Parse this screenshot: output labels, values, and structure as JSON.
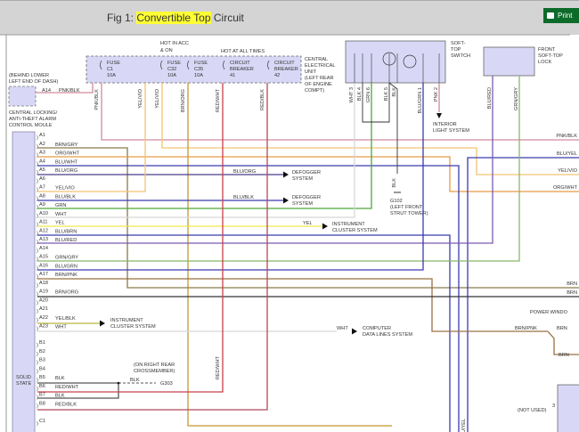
{
  "header": {
    "title_prefix": "Fig 1: ",
    "title_highlight": "Convertible Top",
    "title_suffix": " Circuit",
    "print_label": "Print",
    "highlight_color": "#ffff33",
    "print_color": "#0d6b2a"
  },
  "diagram": {
    "alarm_module": {
      "location": [
        "(BEHIND LOWER",
        "LEFT END OF DASH)"
      ],
      "name": [
        "CENTRAL LOCKING/",
        "ANTI-THEFT ALARM",
        "CONTROL MOULE"
      ],
      "pin": "A14",
      "wire": "PNK/BLK"
    },
    "cel": {
      "hot_acc": [
        "HOT IN ACC",
        "& ON"
      ],
      "hot_all": "HOT AT ALL TIMES",
      "fuses": [
        {
          "l1": "FUSE",
          "l2": "C1",
          "l3": "10A"
        },
        {
          "l1": "FUSE",
          "l2": "C32",
          "l3": "10A"
        },
        {
          "l1": "FUSE",
          "l2": "C35",
          "l3": "10A"
        },
        {
          "l1": "CIRCUIT",
          "l2": "BREAKER",
          "l3": "41"
        },
        {
          "l1": "CIRCUIT",
          "l2": "BREAKER",
          "l3": "42"
        }
      ],
      "name": [
        "CENTRAL",
        "ELECTRICAL",
        "UNIT",
        "(LEFT REAR",
        "OF ENGINE",
        "COMPT)"
      ],
      "wires": [
        "PNK/BLK",
        "YEL/VIO",
        "YEL/VIO",
        "BRN/ORG",
        "RED/WHT",
        "RED/BLK"
      ]
    },
    "switch": {
      "name": [
        "SOFT-",
        "TOP",
        "SWITCH"
      ],
      "pins": [
        {
          "wire": "WHT",
          "pin": "3"
        },
        {
          "wire": "BLK",
          "pin": "4"
        },
        {
          "wire": "GRN",
          "pin": "6"
        },
        {
          "wire": "BLK",
          "pin": "5"
        },
        {
          "wire": "BLK",
          "pin": ""
        },
        {
          "wire": "BLU/GRN",
          "pin": "1"
        },
        {
          "wire": "PNK",
          "pin": "2"
        }
      ],
      "interior": [
        "INTERIOR",
        "LIGHT SYSTEM"
      ],
      "ground_wire": "BLK",
      "ground": [
        "G102",
        "(LEFT FRONT",
        "STRUT TOWER)"
      ]
    },
    "lock": {
      "name": [
        "FRONT",
        "SOFT-TOP",
        "LOCK"
      ],
      "wires": [
        "BLU/RED",
        "GRN/GRY"
      ]
    },
    "module": {
      "name": [
        "SOLID",
        "STATE"
      ],
      "pins": [
        {
          "pin": "A1",
          "wire": ""
        },
        {
          "pin": "A2",
          "wire": "BRN/GRY"
        },
        {
          "pin": "A3",
          "wire": "ORG/WHT"
        },
        {
          "pin": "A4",
          "wire": "BLU/WHT"
        },
        {
          "pin": "A5",
          "wire": "BLU/ORG"
        },
        {
          "pin": "A6",
          "wire": ""
        },
        {
          "pin": "A7",
          "wire": "YEL/VIO"
        },
        {
          "pin": "A8",
          "wire": "BLU/BLK"
        },
        {
          "pin": "A9",
          "wire": "GRN"
        },
        {
          "pin": "A10",
          "wire": "WHT"
        },
        {
          "pin": "A11",
          "wire": "YEL"
        },
        {
          "pin": "A12",
          "wire": "BLU/BRN"
        },
        {
          "pin": "A13",
          "wire": "BLU/RED"
        },
        {
          "pin": "A14",
          "wire": ""
        },
        {
          "pin": "A15",
          "wire": "GRN/GRY"
        },
        {
          "pin": "A16",
          "wire": "BLU/GRN"
        },
        {
          "pin": "A17",
          "wire": "BRN/PNK"
        },
        {
          "pin": "A18",
          "wire": ""
        },
        {
          "pin": "A19",
          "wire": "BRN/ORG"
        },
        {
          "pin": "A20",
          "wire": ""
        },
        {
          "pin": "A21",
          "wire": ""
        },
        {
          "pin": "A22",
          "wire": "YEL/BLK"
        },
        {
          "pin": "A23",
          "wire": "WHT"
        },
        {
          "pin": "B1",
          "wire": ""
        },
        {
          "pin": "B2",
          "wire": ""
        },
        {
          "pin": "B3",
          "wire": ""
        },
        {
          "pin": "B4",
          "wire": ""
        },
        {
          "pin": "B5",
          "wire": "BLK"
        },
        {
          "pin": "B6",
          "wire": "RED/WHT"
        },
        {
          "pin": "B7",
          "wire": "BLK"
        },
        {
          "pin": "B8",
          "wire": "RED/BLK"
        },
        {
          "pin": "C1",
          "wire": ""
        }
      ]
    },
    "destinations": {
      "defogger1": {
        "wire": "BLU/ORG",
        "name": [
          "DEFOGGER",
          "SYSTEM"
        ]
      },
      "defogger2": {
        "wire": "BLU/BLK",
        "name": [
          "DEFOGGER",
          "SYSTEM"
        ]
      },
      "cluster1": {
        "wire": "YEL",
        "name": [
          "INSTRUMENT",
          "CLUSTER SYSTEM"
        ]
      },
      "cluster2": {
        "name": [
          "INSTRUMENT",
          "CLUSTER SYSTEM"
        ]
      },
      "data_lines": {
        "wire": "WHT",
        "name": [
          "COMPUTER",
          "DATA LINES SYSTEM"
        ]
      },
      "g303": {
        "location": [
          "(ON RIGHT REAR",
          "CROSSMEMBER)"
        ],
        "wire": "BLK",
        "name": "G303"
      }
    },
    "right_edge": [
      "PNK/BLK",
      "BLU/YEL",
      "YEL/VIO",
      "ORG/WHT",
      "BRN",
      "BRN"
    ],
    "power_window": {
      "name": "POWER WINDO",
      "wire_in": "BRN/PNK",
      "wire_out1": "BRN",
      "wire_out2": "BRN",
      "not_used": "(NOT USED)",
      "pin": "3"
    },
    "vertical_label": {
      "red_wht": "RED/WHT",
      "blu_yel": "BLU/YEL"
    },
    "colors": {
      "pink": "#d08a9c",
      "yelvio": "#f2c474",
      "brnorg": "#c8962e",
      "red": "#c8404c",
      "redblk": "#b04a5a",
      "brngry": "#8a7a4a",
      "orgwht": "#e89a48",
      "blue": "#3a3ab0",
      "bluorg": "#4a3a8a",
      "green": "#4aa83a",
      "white": "#d8d8d8",
      "yellow": "#f2e84a",
      "purple": "#7a5ab0",
      "grngry": "#88b868",
      "brnpnk": "#9a7040",
      "dark": "#333333",
      "olive": "#b8b83a",
      "gray": "#555555",
      "box": "#d8d8f6"
    }
  }
}
